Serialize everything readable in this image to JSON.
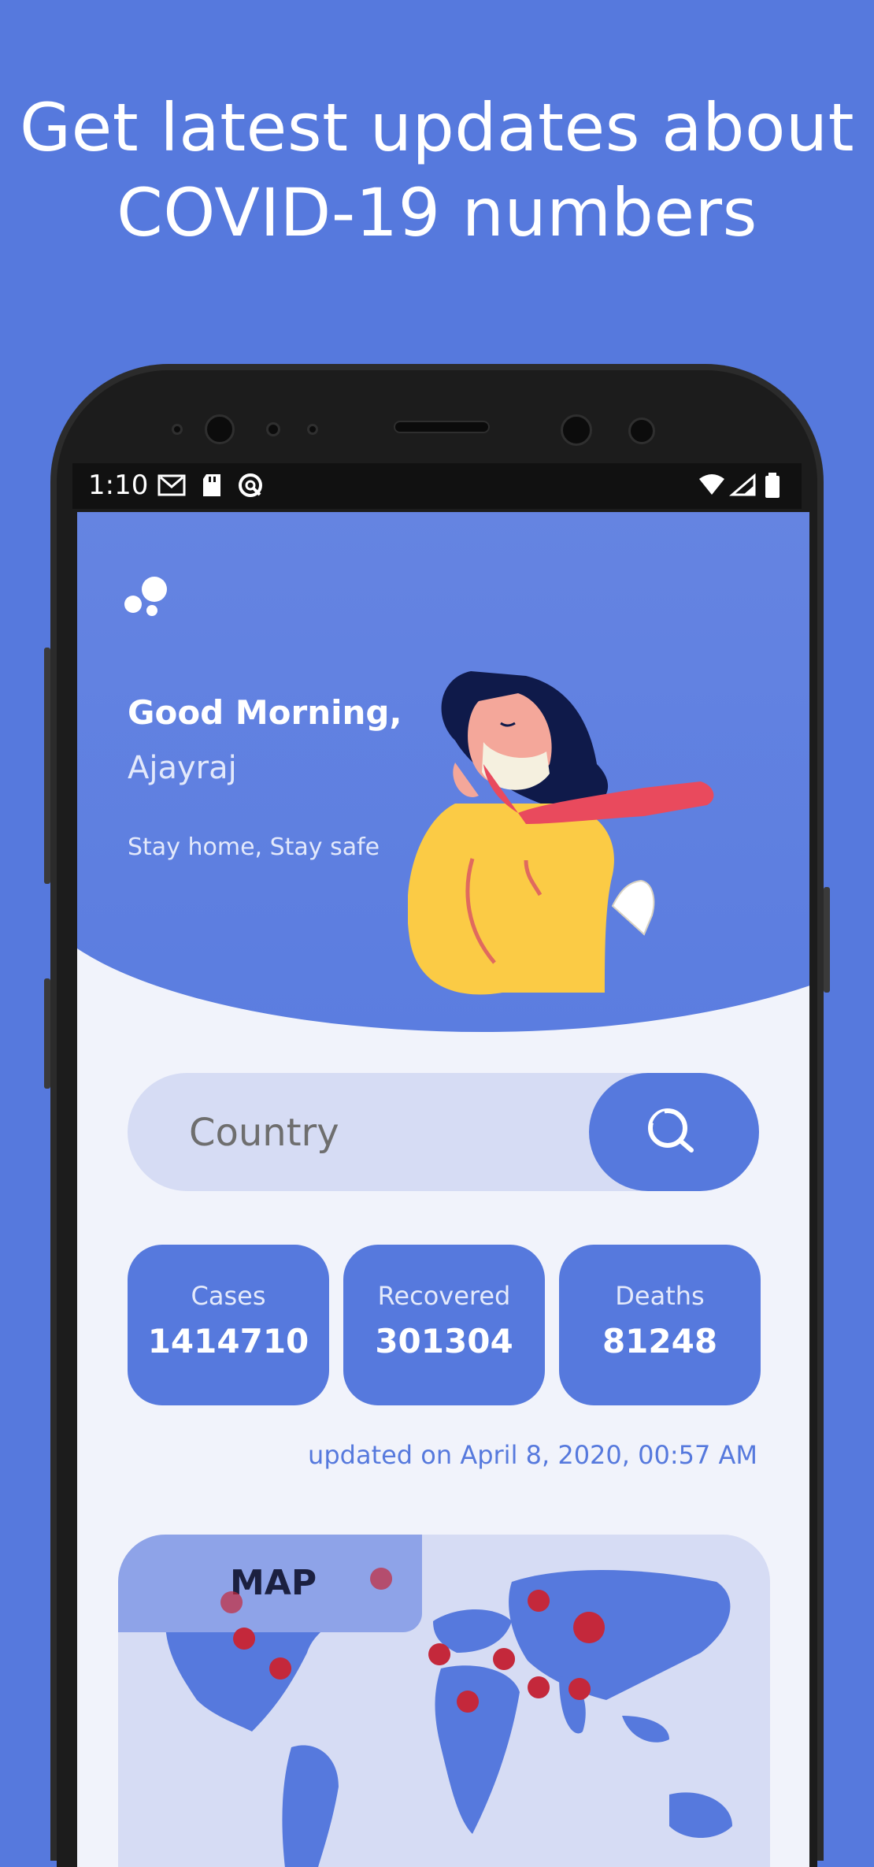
{
  "headline": {
    "line1": "Get latest updates about",
    "line2": "COVID-19 numbers"
  },
  "status_bar": {
    "time": "1:10",
    "left_icons": [
      "gmail-icon",
      "sd-card-icon",
      "sync-icon"
    ],
    "right_icons": [
      "wifi-icon",
      "signal-icon",
      "battery-icon"
    ]
  },
  "greeting": {
    "title": "Good Morning,",
    "name": "Ajayraj",
    "tagline": "Stay home, Stay safe"
  },
  "search": {
    "placeholder": "Country",
    "button_icon": "search-icon"
  },
  "stats": [
    {
      "label": "Cases",
      "value": "1414710"
    },
    {
      "label": "Recovered",
      "value": "301304"
    },
    {
      "label": "Deaths",
      "value": "81248"
    }
  ],
  "updated_text": "updated on April 8, 2020, 00:57 AM",
  "map": {
    "label": "MAP"
  },
  "colors": {
    "background": "#5679dd",
    "accent": "#5679dd",
    "card_light": "#d6dcf4",
    "screen_bg": "#f1f3fb",
    "pin": "#c4283b"
  }
}
